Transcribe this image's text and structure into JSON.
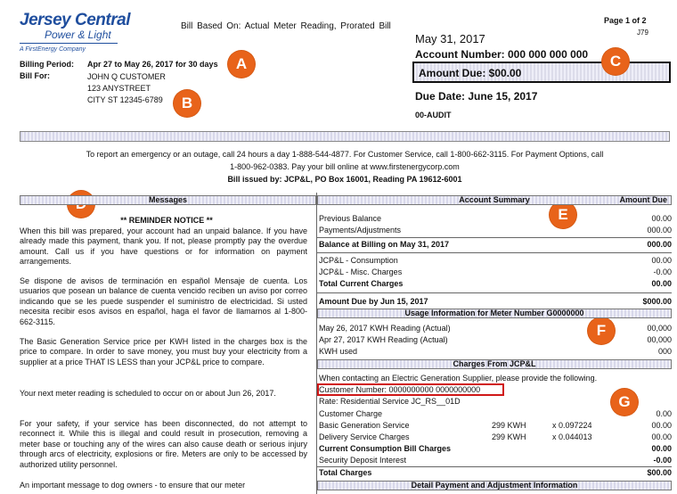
{
  "logo": {
    "main": "Jersey Central",
    "sub": "Power & Light",
    "tagline": "A FirstEnergy Company"
  },
  "header": {
    "bill_based_on": "Bill Based On: Actual Meter Reading, Prorated Bill",
    "page": "Page 1 of 2",
    "code": "J79",
    "bill_date": "May 31, 2017",
    "account": "Account Number: 000 000 000 000",
    "amount_due": "Amount Due:  $00.00",
    "due_date": "Due Date:  June 15, 2017",
    "audit": "00-AUDIT"
  },
  "billing": {
    "period_label": "Billing Period:",
    "period_value": "Apr 27 to May 26, 2017 for 30 days",
    "for_label": "Bill For:",
    "name": "JOHN Q CUSTOMER",
    "street": "123 ANYSTREET",
    "city": "CITY ST 12345-6789"
  },
  "badges": [
    "A",
    "B",
    "C",
    "D",
    "E",
    "F",
    "G"
  ],
  "contact": {
    "line1": "To report an emergency or an outage, call 24 hours a day 1-888-544-4877.  For Customer Service, call 1-800-662-3115.  For Payment Options, call",
    "line2": "1-800-962-0383.   Pay your bill online at www.firstenergycorp.com",
    "line3": "Bill issued by: JCP&L, PO Box 16001, Reading  PA 19612-6001"
  },
  "messages": {
    "header": "Messages",
    "title": "** REMINDER NOTICE **",
    "paragraphs": [
      "When this bill was prepared, your account had an unpaid balance.  If you have already made this payment, thank you.  If not, please promptly pay the overdue amount.  Call us if you have questions or for information on payment arrangements.",
      "Se dispone de avisos de terminación en español Mensaje de cuenta. Los usuarios que posean un balance de cuenta vencido reciben un aviso por correo indicando que se les puede suspender el suministro de electricidad.  Si usted necesita recibir esos avisos en español, haga el favor de llamarnos al 1-800-662-3115.",
      "The Basic Generation Service price per KWH listed in the charges box is the price to compare. In order to save money, you must buy your electricity from a supplier at a price THAT IS LESS than your JCP&L price to compare.",
      "Your next meter reading is scheduled to occur on or about Jun 26, 2017.",
      "For your safety, if your service has been disconnected, do not attempt to reconnect it.  While this is illegal and could result in prosecution, removing a meter base or touching any of the wires can also cause death or serious injury through arcs of electricity, explosions or fire. Meters are only to be accessed by authorized utility personnel.",
      "An important message to dog owners - to ensure that our meter"
    ]
  },
  "summary": {
    "header_left": "Account Summary",
    "header_right": "Amount Due",
    "rows": [
      {
        "label": "Previous Balance",
        "value": "00.00"
      },
      {
        "label": "Payments/Adjustments",
        "value": "000.00"
      },
      {
        "label": "Balance at Billing on May 31, 2017",
        "value": "000.00"
      },
      {
        "label": "JCP&L - Consumption",
        "value": "00.00"
      },
      {
        "label": "JCP&L - Misc. Charges",
        "value": "-0.00"
      },
      {
        "label": "Total Current Charges",
        "value": "00.00"
      },
      {
        "label": "Amount Due by Jun 15, 2017",
        "value": "$000.00"
      }
    ]
  },
  "usage": {
    "header": "Usage Information for Meter Number G0000000",
    "rows": [
      {
        "label": "May 26, 2017 KWH Reading (Actual)",
        "value": "00,000"
      },
      {
        "label": "Apr 27, 2017 KWH Reading (Actual)",
        "value": "00,000"
      },
      {
        "label": "KWH used",
        "value": "000"
      }
    ]
  },
  "charges": {
    "header": "Charges From JCP&L",
    "note": "When contacting an Electric Generation Supplier, please provide the following.",
    "customer_number": "Customer Number:  0000000000 0000000000",
    "rate": "Rate:  Residential Service JC_RS__01D",
    "rows": [
      {
        "label": "Customer Charge",
        "qty": "",
        "rate": "",
        "value": "0.00"
      },
      {
        "label": "Basic Generation Service",
        "qty": "299  KWH",
        "rate": "x  0.097224",
        "value": "00.00"
      },
      {
        "label": "Delivery Service Charges",
        "qty": "299  KWH",
        "rate": "x  0.044013",
        "value": "00.00"
      },
      {
        "label": "Current Consumption Bill Charges",
        "qty": "",
        "rate": "",
        "value": "00.00"
      },
      {
        "label": "Security Deposit Interest",
        "qty": "",
        "rate": "",
        "value": "-0.00"
      },
      {
        "label": "Total Charges",
        "qty": "",
        "rate": "",
        "value": "$00.00"
      }
    ],
    "footer_header": "Detail Payment and Adjustment Information"
  },
  "colors": {
    "badge": "#e8631a",
    "logo": "#1f4e9e",
    "highlight": "#d01818"
  }
}
